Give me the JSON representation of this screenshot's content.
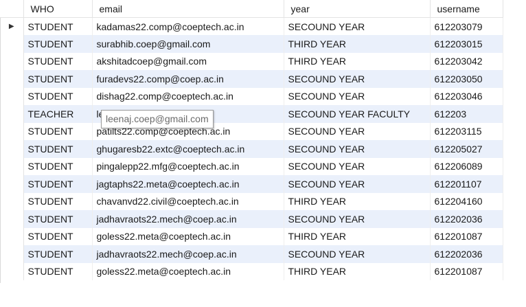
{
  "columns": [
    "WHO",
    "email",
    "year",
    "username"
  ],
  "row_indicator": "▶",
  "rows": [
    [
      "STUDENT",
      "kadamas22.comp@coeptech.ac.in",
      "SECOUND YEAR",
      "612203079"
    ],
    [
      "STUDENT",
      "surabhib.coep@gmail.com",
      "THIRD YEAR",
      "612203015"
    ],
    [
      "STUDENT",
      "akshitadcoep@gmail.com",
      "THIRD YEAR",
      "612203042"
    ],
    [
      "STUDENT",
      "furadevs22.comp@coep.ac.in",
      "SECOUND YEAR",
      "612203050"
    ],
    [
      "STUDENT",
      "dishag22.comp@coeptech.ac.in",
      "SECOUND YEAR",
      "612203046"
    ],
    [
      "TEACHER",
      "le",
      "SECOUND YEAR FACULTY",
      "612203"
    ],
    [
      "STUDENT",
      "patilts22.comp@coeptech.ac.in",
      "SECOUND YEAR",
      "612203115"
    ],
    [
      "STUDENT",
      "ghugaresb22.extc@coeptech.ac.in",
      "SECOUND YEAR",
      "612205027"
    ],
    [
      "STUDENT",
      "pingalepp22.mfg@coeptech.ac.in",
      "SECOUND YEAR",
      "612206089"
    ],
    [
      "STUDENT",
      "jagtaphs22.meta@coeptech.ac.in",
      "SECOUND YEAR",
      "612201107"
    ],
    [
      "STUDENT",
      "chavanvd22.civil@coeptech.ac.in",
      "THIRD YEAR",
      "612204160"
    ],
    [
      "STUDENT",
      "jadhavraots22.mech@coep.ac.in",
      "SECOUND YEAR",
      "612202036"
    ],
    [
      "STUDENT",
      "goless22.meta@coeptech.ac.in",
      "THIRD YEAR",
      "612201087"
    ],
    [
      "STUDENT",
      "jadhavraots22.mech@coep.ac.in",
      "SECOUND YEAR",
      "612202036"
    ],
    [
      "STUDENT",
      "goless22.meta@coeptech.ac.in",
      "THIRD YEAR",
      "612201087"
    ]
  ],
  "tooltip": "leenaj.coep@gmail.com",
  "colors": {
    "alt_row": "#eaf0fb",
    "grid_line": "#e3e3e3"
  }
}
